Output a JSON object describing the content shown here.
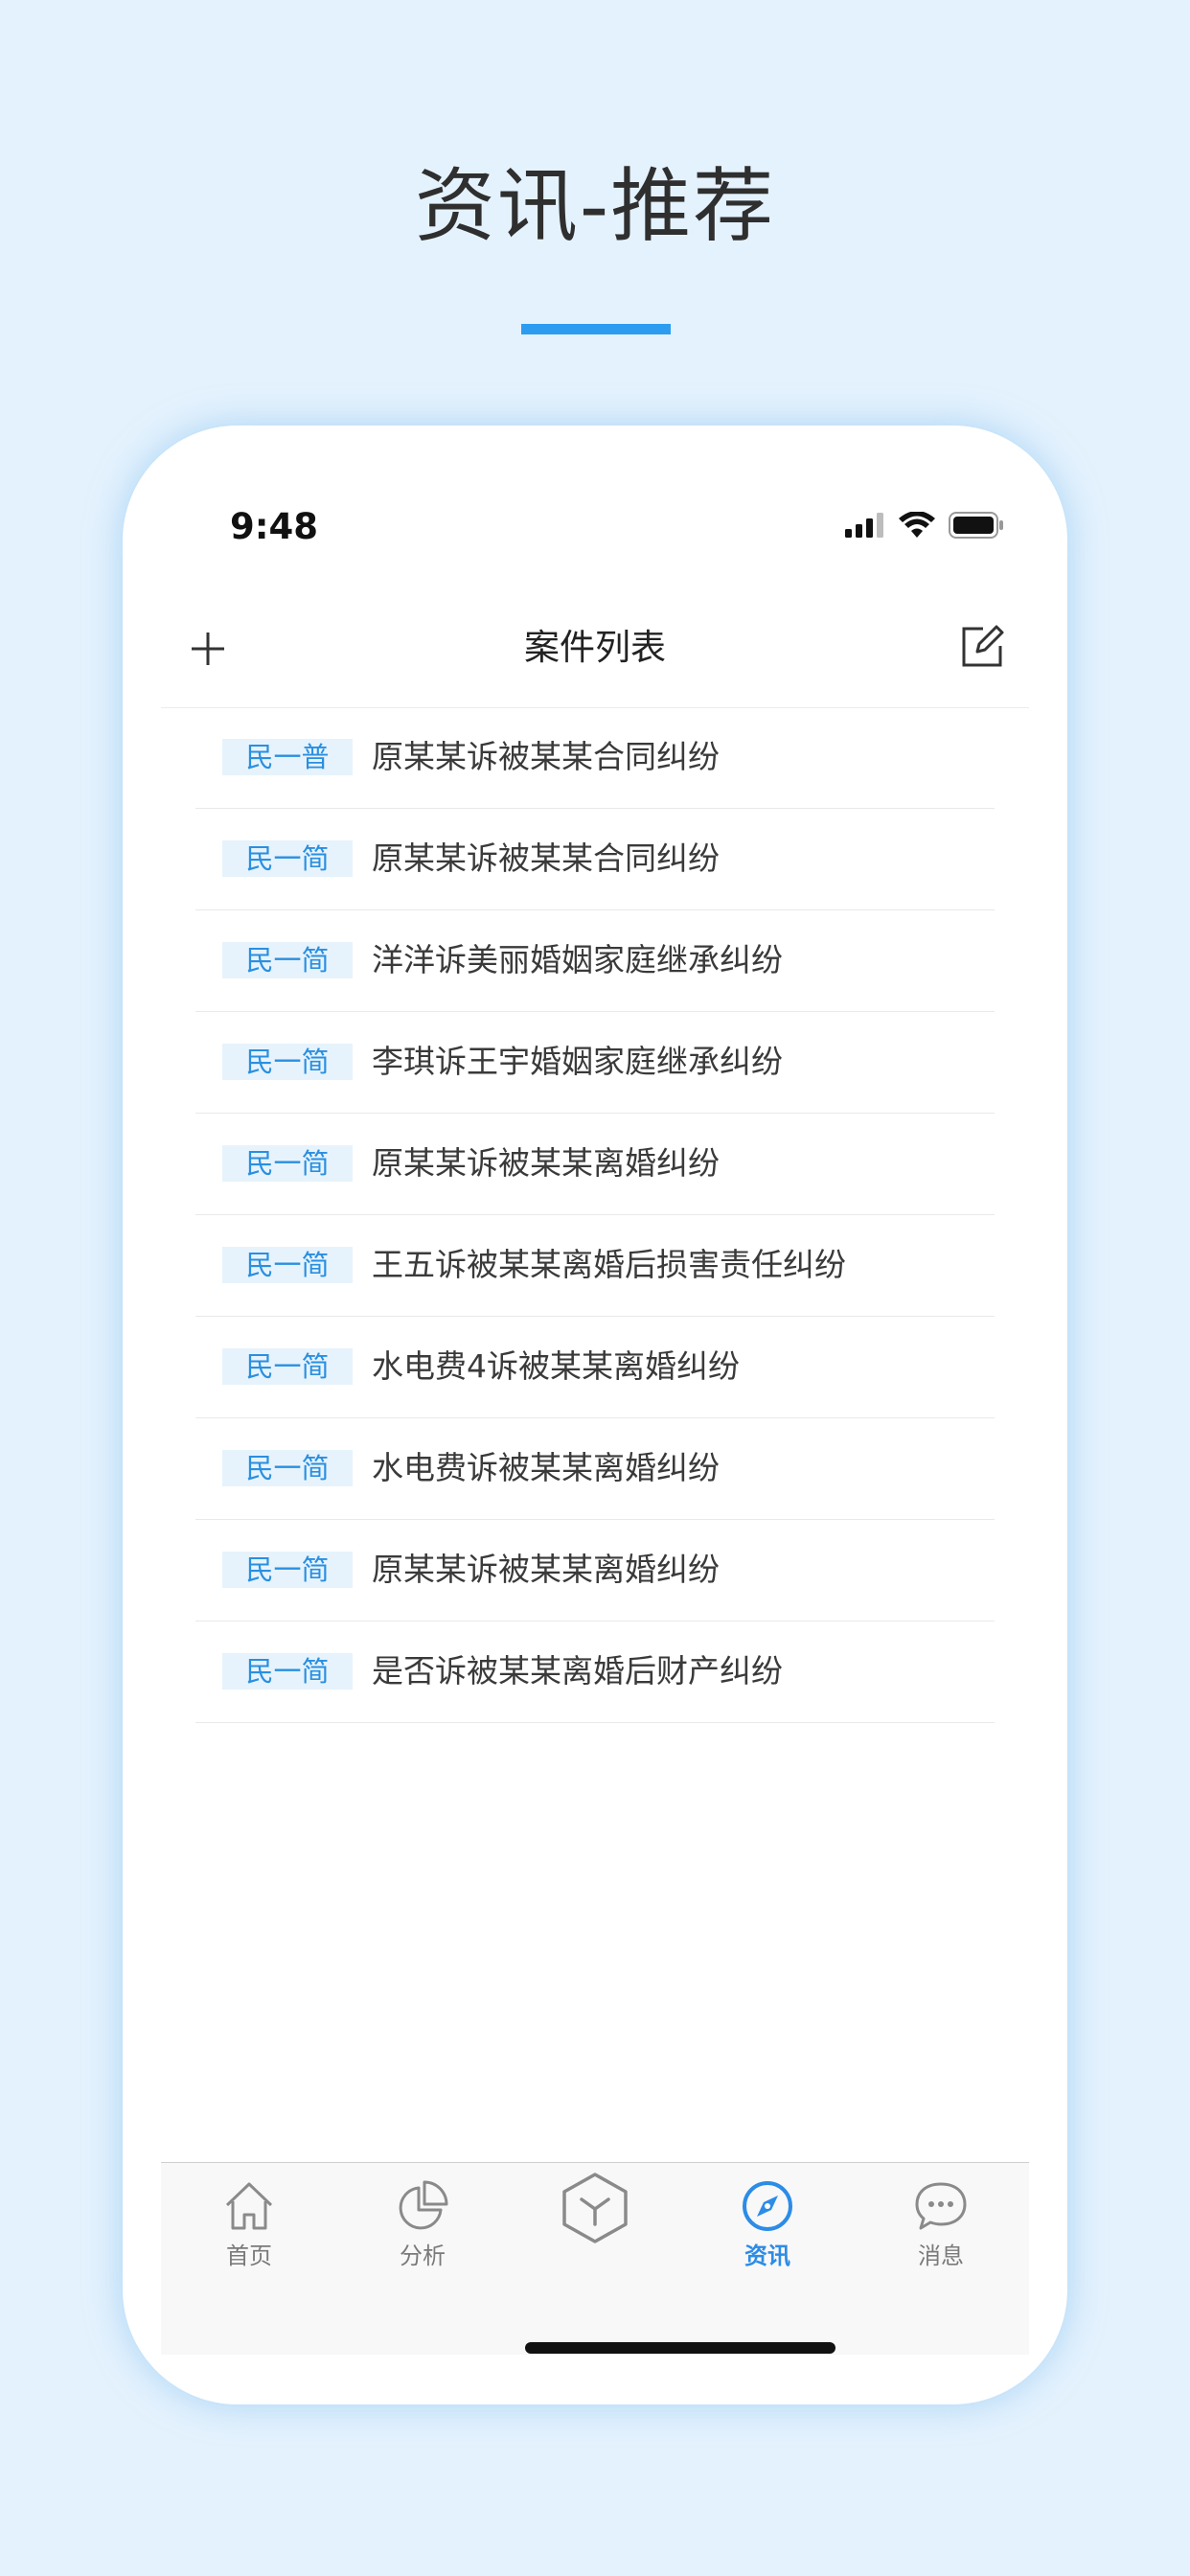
{
  "headline": "资讯-推荐",
  "colors": {
    "accent": "#2c9cf0",
    "badge_bg": "#e6f3fc",
    "badge_text": "#2a8fe0",
    "background": "#e4f2fd"
  },
  "status_bar": {
    "time": "9:48",
    "icons": [
      "cellular-signal-icon",
      "wifi-icon",
      "battery-icon"
    ]
  },
  "nav": {
    "title": "案件列表",
    "left_icon": "plus-icon",
    "right_icon": "edit-icon"
  },
  "cases": [
    {
      "badge": "民一普",
      "title": "原某某诉被某某合同纠纷"
    },
    {
      "badge": "民一简",
      "title": "原某某诉被某某合同纠纷"
    },
    {
      "badge": "民一简",
      "title": "洋洋诉美丽婚姻家庭继承纠纷"
    },
    {
      "badge": "民一简",
      "title": "李琪诉王宇婚姻家庭继承纠纷"
    },
    {
      "badge": "民一简",
      "title": "原某某诉被某某离婚纠纷"
    },
    {
      "badge": "民一简",
      "title": "王五诉被某某离婚后损害责任纠纷"
    },
    {
      "badge": "民一简",
      "title": "水电费4诉被某某离婚纠纷"
    },
    {
      "badge": "民一简",
      "title": "水电费诉被某某离婚纠纷"
    },
    {
      "badge": "民一简",
      "title": "原某某诉被某某离婚纠纷"
    },
    {
      "badge": "民一简",
      "title": "是否诉被某某离婚后财产纠纷"
    }
  ],
  "tabs": [
    {
      "label": "首页",
      "icon": "home-icon",
      "active": false
    },
    {
      "label": "分析",
      "icon": "pie-chart-icon",
      "active": false
    },
    {
      "label": "",
      "icon": "cube-icon",
      "active": false
    },
    {
      "label": "资讯",
      "icon": "compass-icon",
      "active": true
    },
    {
      "label": "消息",
      "icon": "chat-bubble-icon",
      "active": false
    }
  ]
}
